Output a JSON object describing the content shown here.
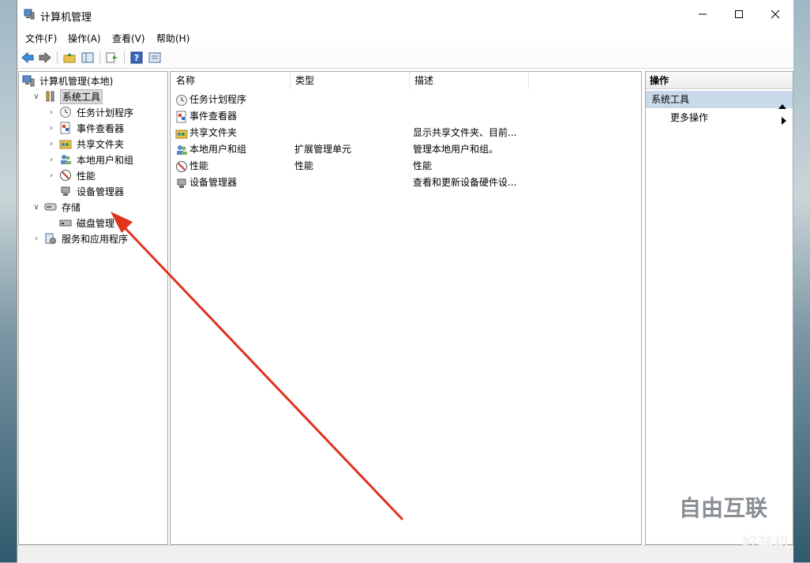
{
  "window": {
    "title": "计算机管理",
    "controls": {
      "minimize": "minimize-icon",
      "maximize": "maximize-icon",
      "close": "close-icon"
    }
  },
  "menu": [
    "文件(F)",
    "操作(A)",
    "查看(V)",
    "帮助(H)"
  ],
  "toolbar": [
    "back-arrow-icon",
    "forward-arrow-icon",
    "up-folder-icon",
    "show-hide-tree-icon",
    "export-list-icon",
    "help-icon",
    "properties-icon"
  ],
  "tree": [
    {
      "label": "计算机管理(本地)",
      "icon": "computer-management-icon",
      "level": 0,
      "chevron": ""
    },
    {
      "label": "系统工具",
      "icon": "tools-icon",
      "level": 1,
      "chevron": "down",
      "selected": true
    },
    {
      "label": "任务计划程序",
      "icon": "clock-icon",
      "level": 2,
      "chevron": "right"
    },
    {
      "label": "事件查看器",
      "icon": "event-viewer-icon",
      "level": 2,
      "chevron": "right"
    },
    {
      "label": "共享文件夹",
      "icon": "shared-folder-icon",
      "level": 2,
      "chevron": "right"
    },
    {
      "label": "本地用户和组",
      "icon": "users-icon",
      "level": 2,
      "chevron": "right"
    },
    {
      "label": "性能",
      "icon": "performance-icon",
      "level": 2,
      "chevron": "right"
    },
    {
      "label": "设备管理器",
      "icon": "device-manager-icon",
      "level": 2,
      "chevron": ""
    },
    {
      "label": "存储",
      "icon": "storage-icon",
      "level": 1,
      "chevron": "down"
    },
    {
      "label": "磁盘管理",
      "icon": "disk-icon",
      "level": 2,
      "chevron": ""
    },
    {
      "label": "服务和应用程序",
      "icon": "services-icon",
      "level": 1,
      "chevron": "right"
    }
  ],
  "list": {
    "columns": [
      "名称",
      "类型",
      "描述"
    ],
    "rows": [
      {
        "name": "任务计划程序",
        "type": "",
        "desc": "",
        "icon": "clock-icon"
      },
      {
        "name": "事件查看器",
        "type": "",
        "desc": "",
        "icon": "event-viewer-icon"
      },
      {
        "name": "共享文件夹",
        "type": "",
        "desc": "显示共享文件夹、目前...",
        "icon": "shared-folder-icon"
      },
      {
        "name": "本地用户和组",
        "type": "扩展管理单元",
        "desc": "管理本地用户和组。",
        "icon": "users-icon"
      },
      {
        "name": "性能",
        "type": "性能",
        "desc": "性能",
        "icon": "performance-icon"
      },
      {
        "name": "设备管理器",
        "type": "",
        "desc": "查看和更新设备硬件设...",
        "icon": "device-manager-icon"
      }
    ]
  },
  "actions": {
    "header": "操作",
    "section": "系统工具",
    "item": "更多操作"
  },
  "watermark": {
    "brand": "自由互联",
    "brand2": "好装机"
  },
  "colors": {
    "accent": "#c9d9ea",
    "annotation_arrow": "#e0331f"
  }
}
